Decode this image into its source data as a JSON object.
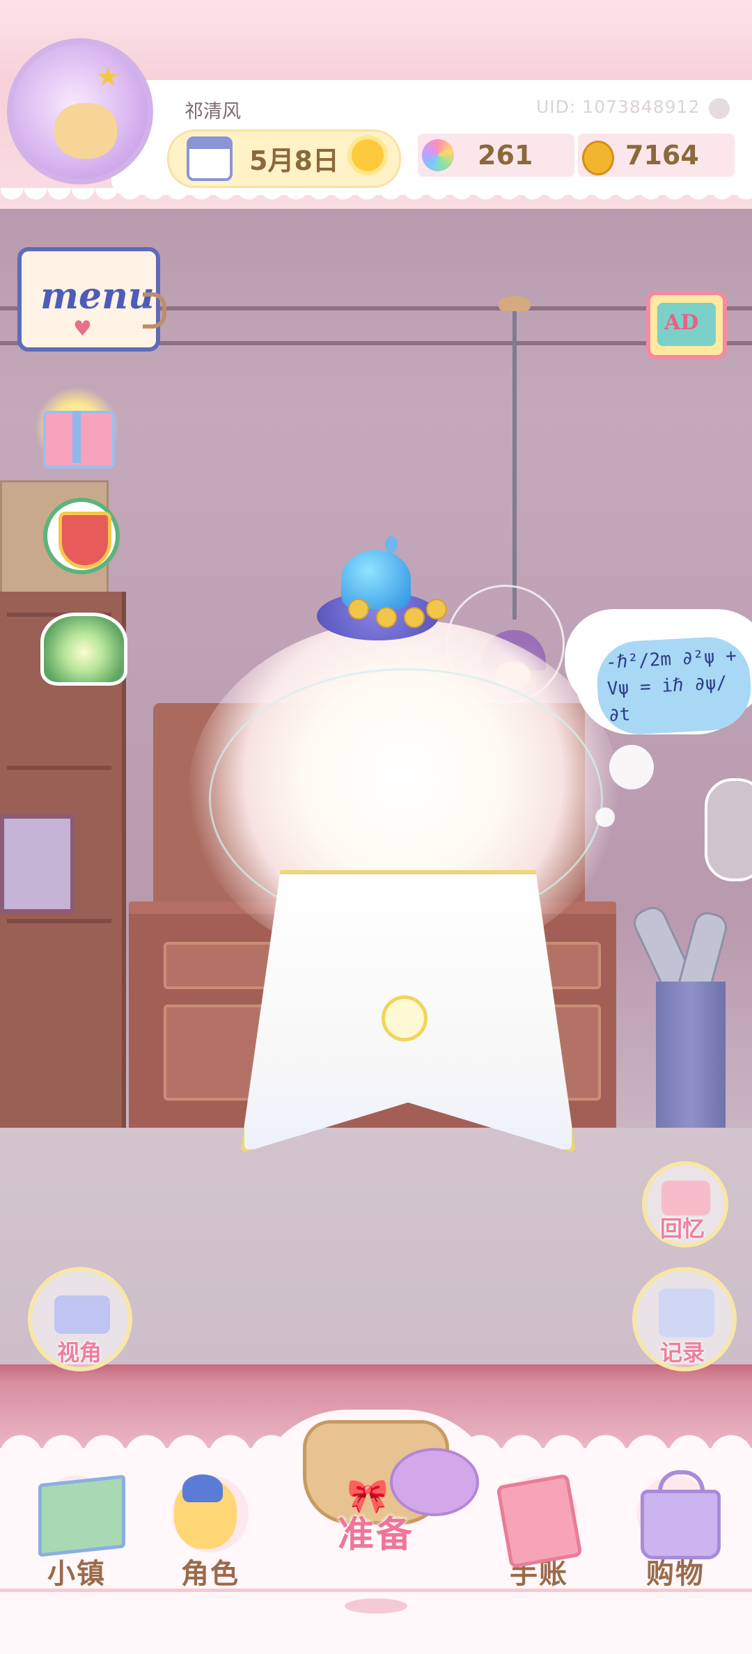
{
  "header": {
    "username": "祁清风",
    "uid": "UID: 1073848912",
    "date": "5月8日",
    "weather_icon": "sun-icon",
    "gems": "261",
    "coins": "7164"
  },
  "left_icons": {
    "menu_label": "menu"
  },
  "right_icons": {
    "ad_label": "AD",
    "memory_label": "回忆",
    "record_label": "记录"
  },
  "camera_label": "视角",
  "thought_text": "-ℏ²/2m ∂²ψ + Vψ = iℏ ∂ψ/∂t",
  "bottom_nav": {
    "items": [
      {
        "label": "小镇",
        "icon": "map-icon"
      },
      {
        "label": "角色",
        "icon": "character-icon"
      },
      {
        "label": "准备",
        "icon": "basket-icon"
      },
      {
        "label": "手账",
        "icon": "journal-icon"
      },
      {
        "label": "购物",
        "icon": "shopping-bag-icon"
      }
    ]
  },
  "colors": {
    "accent_pink": "#f07598",
    "nav_label_brown": "#9a6b4a",
    "hud_bg": "#fbe3e8",
    "coin_gold": "#f1b52e"
  }
}
